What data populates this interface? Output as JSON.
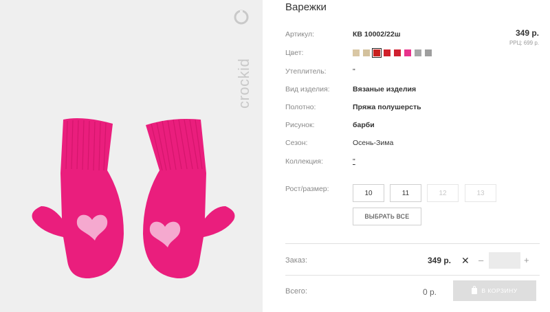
{
  "product": {
    "title": "Варежки",
    "brand_logo_text": "crockid"
  },
  "details": {
    "article_label": "Артикул:",
    "article_value": "КВ 10002/22ш",
    "color_label": "Цвет:",
    "insulation_label": "Утеплитель:",
    "insulation_value": "\"",
    "type_label": "Вид изделия:",
    "type_value": "Вязаные изделия",
    "fabric_label": "Полотно:",
    "fabric_value": "Пряжа полушерсть",
    "pattern_label": "Рисунок:",
    "pattern_value": "барби",
    "season_label": "Сезон:",
    "season_value": "Осень-Зима",
    "collection_label": "Коллекция:",
    "collection_value": "\"",
    "size_label": "Рост/размер:"
  },
  "price": {
    "main": "349 р.",
    "rrc_label": "РРЦ:",
    "rrc_value": "699 р."
  },
  "colors": [
    {
      "hex": "#d9c7a4",
      "selected": false
    },
    {
      "hex": "#d3c19d",
      "selected": false
    },
    {
      "hex": "#c8201e",
      "selected": true
    },
    {
      "hex": "#d0202a",
      "selected": false
    },
    {
      "hex": "#cf2030",
      "selected": false
    },
    {
      "hex": "#e8338c",
      "selected": false
    },
    {
      "hex": "#a7a7a7",
      "selected": false
    },
    {
      "hex": "#9e9e9e",
      "selected": false
    }
  ],
  "sizes": [
    {
      "label": "10",
      "enabled": true
    },
    {
      "label": "11",
      "enabled": true
    },
    {
      "label": "12",
      "enabled": false
    },
    {
      "label": "13",
      "enabled": false
    }
  ],
  "select_all_label": "ВЫБРАТЬ ВСЕ",
  "order": {
    "label": "Заказ:",
    "price": "349 р.",
    "quantity": "",
    "minus": "–",
    "plus": "+"
  },
  "total": {
    "label": "Всего:",
    "value": "0 р.",
    "cart_button_label": "В КОРЗИНУ"
  },
  "icons": {
    "remove": "close-icon",
    "cart": "shopping-bag-icon"
  }
}
